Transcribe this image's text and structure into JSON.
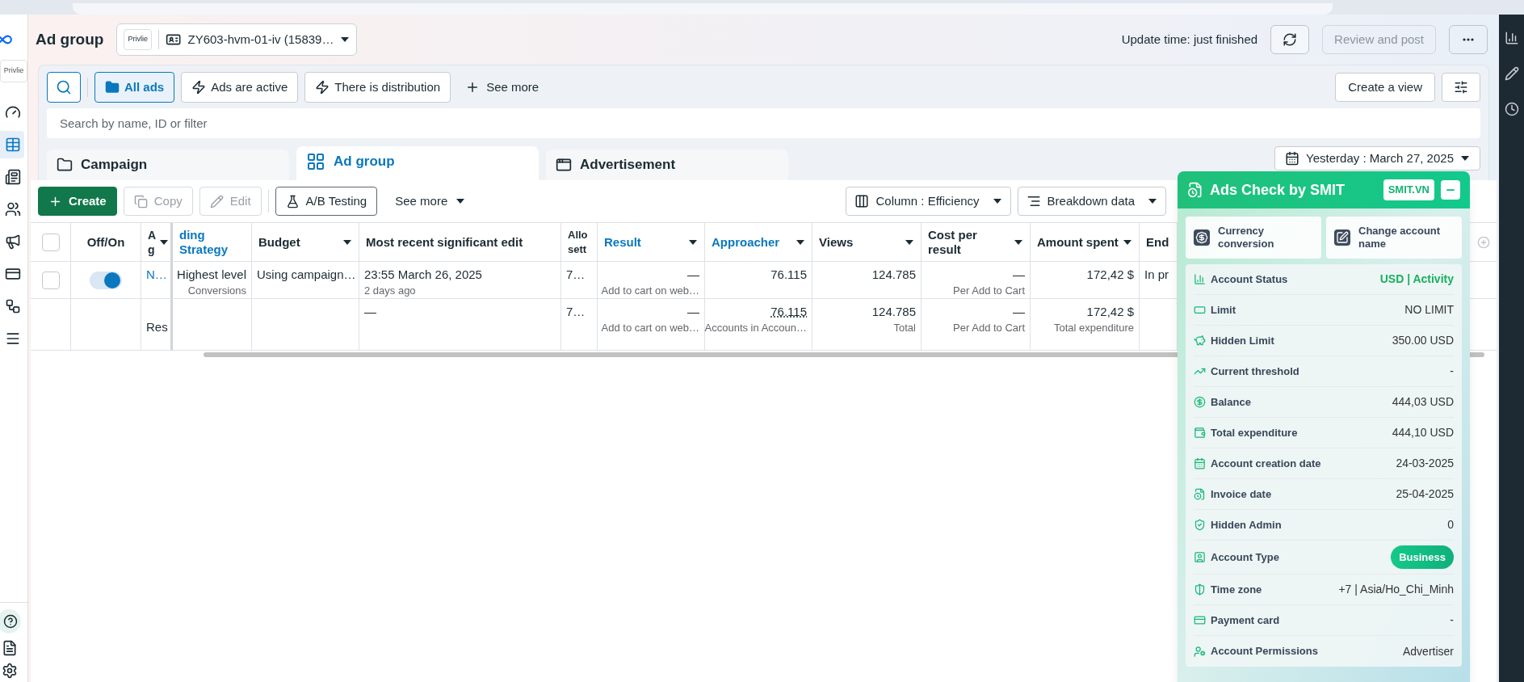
{
  "left_nav": {
    "brand_logo": "Privlie",
    "items": [
      {
        "selected": false
      },
      {
        "selected": true
      },
      {
        "selected": false
      },
      {
        "selected": false
      },
      {
        "selected": false
      },
      {
        "selected": false
      },
      {
        "selected": false
      },
      {
        "selected": false
      }
    ]
  },
  "header": {
    "title": "Ad group",
    "account": {
      "logo": "Privlie",
      "name": "ZY603-hvm-01-iv (15839…"
    },
    "update_time": "Update time: just finished",
    "review_button": {
      "label": "Review and post",
      "disabled": true
    }
  },
  "filters": {
    "chips": [
      {
        "label": "All ads",
        "selected": true
      },
      {
        "label": "Ads are active",
        "selected": false
      },
      {
        "label": "There is distribution",
        "selected": false
      }
    ],
    "see_more": "See more",
    "create_view": "Create a view",
    "search": {
      "placeholder": "Search by name, ID or filter"
    }
  },
  "level_tabs": [
    {
      "label": "Campaign",
      "selected": false
    },
    {
      "label": "Ad group",
      "selected": true
    },
    {
      "label": "Advertisement",
      "selected": false
    }
  ],
  "date_range": "Yesterday : March 27, 2025",
  "toolbar": {
    "buttons": [
      {
        "label": "Create",
        "kind": "primary",
        "disabled": false
      },
      {
        "label": "Copy",
        "kind": "plain",
        "disabled": true
      },
      {
        "label": "Edit",
        "kind": "plain",
        "disabled": true
      },
      {
        "label": "A/B Testing",
        "kind": "outline",
        "disabled": false
      }
    ],
    "see_more": "See more",
    "columns": "Column : Efficiency",
    "breakdown": "Breakdown data"
  },
  "table": {
    "select_all": {
      "selected": false
    },
    "columns": [
      {
        "label": "Off/On",
        "menu": false,
        "link": false
      },
      {
        "label": "A\ng",
        "menu": true,
        "link": false
      },
      {
        "label": "ding Strategy",
        "menu": false,
        "link": true
      },
      {
        "label": "Budget",
        "menu": true,
        "link": false
      },
      {
        "label": "Most recent significant edit",
        "menu": false,
        "link": false
      },
      {
        "label": "Allo\nsett",
        "menu": false,
        "link": false
      },
      {
        "label": "Result",
        "menu": true,
        "link": true
      },
      {
        "label": "Approacher",
        "menu": true,
        "link": true
      },
      {
        "label": "Views",
        "menu": true,
        "link": false
      },
      {
        "label": "Cost per result",
        "menu": true,
        "link": false
      },
      {
        "label": "Amount spent",
        "menu": true,
        "link": false
      },
      {
        "label": "End",
        "menu": false,
        "link": false
      }
    ],
    "rows": [
      {
        "kind": "item",
        "selected": false,
        "cells": [
          {
            "kind": "toggle",
            "on": true
          },
          {
            "text": "N…",
            "link": true
          },
          {
            "text": "Highest level",
            "sub": "Conversions"
          },
          {
            "text": "Using campaign…"
          },
          {
            "text": "23:55 March 26, 2025",
            "sub": "2 days ago"
          },
          {
            "text": "7…"
          },
          {
            "text": "—",
            "sub": "Add to cart on web…"
          },
          {
            "text": "76.115"
          },
          {
            "text": "124.785"
          },
          {
            "text": "—",
            "sub": "Per Add to Cart"
          },
          {
            "text": "172,42 $"
          },
          {
            "text": "In pr"
          }
        ]
      },
      {
        "kind": "total",
        "cells": [
          {},
          {
            "text": "Res"
          },
          {},
          {},
          {
            "text": "—"
          },
          {
            "text": "7…"
          },
          {
            "text": "—",
            "sub": "Add to cart on web…"
          },
          {
            "text": "76.115",
            "sub": "Accounts in Accoun…",
            "dotted": true
          },
          {
            "text": "124.785",
            "sub": "Total"
          },
          {
            "text": "—",
            "sub": "Per Add to Cart"
          },
          {
            "text": "172,42 $",
            "sub": "Total expenditure"
          },
          {}
        ]
      }
    ]
  },
  "smit_panel": {
    "title": "Ads Check by SMIT",
    "badge": "SMIT.VN",
    "actions": [
      "Currency conversion",
      "Change account name"
    ],
    "rows": [
      {
        "label": "Account Status",
        "value": "USD | Activity",
        "kind": "status"
      },
      {
        "label": "Limit",
        "value": "NO LIMIT",
        "kind": "text"
      },
      {
        "label": "Hidden Limit",
        "value": "350.00 USD",
        "kind": "text"
      },
      {
        "label": "Current threshold",
        "value": "-",
        "kind": "text"
      },
      {
        "label": "Balance",
        "value": "444,03 USD",
        "kind": "text"
      },
      {
        "label": "Total expenditure",
        "value": "444,10 USD",
        "kind": "text"
      },
      {
        "label": "Account creation date",
        "value": "24-03-2025",
        "kind": "text"
      },
      {
        "label": "Invoice date",
        "value": "25-04-2025",
        "kind": "text"
      },
      {
        "label": "Hidden Admin",
        "value": "0",
        "kind": "text"
      },
      {
        "label": "Account Type",
        "value": "Business",
        "kind": "pill"
      },
      {
        "label": "Time zone",
        "value": "+7 | Asia/Ho_Chi_Minh",
        "kind": "text"
      },
      {
        "label": "Payment card",
        "value": "-",
        "kind": "text"
      },
      {
        "label": "Account Permissions",
        "value": "Advertiser",
        "kind": "text"
      }
    ]
  }
}
